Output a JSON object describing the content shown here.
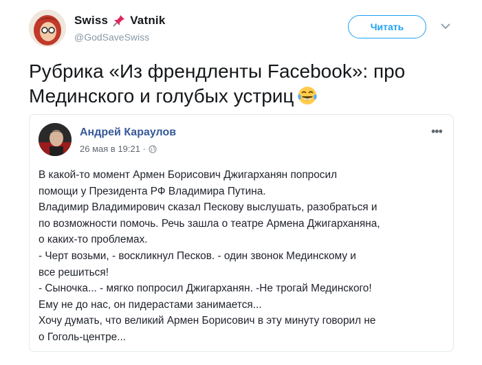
{
  "author": {
    "name_left": "Swiss",
    "name_right": "Vatnik",
    "handle": "@GodSaveSwiss",
    "name_icon": "pushpin-icon"
  },
  "follow_button": "Читать",
  "tweet": {
    "line1": "Рубрика «Из френдленты Facebook»: про",
    "line2": "Мединского и голубых устриц",
    "emoji": "laughing-tears-emoji"
  },
  "card": {
    "name": "Андрей Караулов",
    "date": "26 мая в 19:21 ·",
    "privacy_icon": "globe-icon",
    "menu_icon": "more-dots-icon",
    "lines": [
      "В какой-то момент Армен Борисович Джигарханян попросил",
      "помощи у Президента РФ Владимира Путина.",
      "Владимир Владимирович сказал Пескову выслушать, разобраться и",
      "по возможности помочь. Речь зашла о театре Армена Джигарханяна,",
      "о каких-то проблемах.",
      "- Черт возьми, - воскликнул Песков. - один звонок Мединскому и",
      "все решиться!",
      "- Сыночка... - мягко попросил Джигарханян. -Не трогай Мединского!",
      "Ему не до нас, он пидерастами занимается...",
      "Хочу думать, что великий Армен Борисович в эту минуту говорил не",
      "о Гоголь-центре..."
    ]
  },
  "colors": {
    "follow_blue": "#1da1f2",
    "fb_name_blue": "#365899",
    "handle_gray": "#8899a6"
  }
}
